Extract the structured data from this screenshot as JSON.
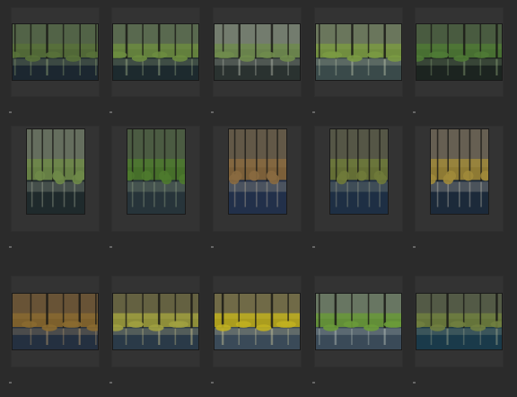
{
  "grid": {
    "items": [
      {
        "name": "photo-thumbnail-1",
        "orientation": "landscape",
        "palette": [
          "#2c3b2c",
          "#58713a",
          "#9bb07a",
          "#1c2730"
        ]
      },
      {
        "name": "photo-thumbnail-2",
        "orientation": "landscape",
        "palette": [
          "#30402f",
          "#6c8c3f",
          "#a7b88c",
          "#1d2a2e"
        ]
      },
      {
        "name": "photo-thumbnail-3",
        "orientation": "landscape",
        "palette": [
          "#4a5548",
          "#6f8b4d",
          "#bfc6b8",
          "#2a3230"
        ]
      },
      {
        "name": "photo-thumbnail-4",
        "orientation": "landscape",
        "palette": [
          "#3c4a30",
          "#7a9a42",
          "#c0c8b0",
          "#3a4a4a"
        ]
      },
      {
        "name": "photo-thumbnail-5",
        "orientation": "landscape",
        "palette": [
          "#263321",
          "#4f7a35",
          "#8da77a",
          "#1c2420"
        ]
      },
      {
        "name": "photo-thumbnail-6",
        "orientation": "portrait",
        "palette": [
          "#3a4336",
          "#6e8a48",
          "#b6c0a8",
          "#1f2a2c"
        ]
      },
      {
        "name": "photo-thumbnail-7",
        "orientation": "portrait",
        "palette": [
          "#1f2e1a",
          "#4e7a2e",
          "#9fb08e",
          "#27343a"
        ]
      },
      {
        "name": "photo-thumbnail-8",
        "orientation": "portrait",
        "palette": [
          "#2b2418",
          "#8a6a40",
          "#c8bba0",
          "#22304a"
        ]
      },
      {
        "name": "photo-thumbnail-9",
        "orientation": "portrait",
        "palette": [
          "#2a2a20",
          "#6f7a3a",
          "#a5a890",
          "#1e2f44"
        ]
      },
      {
        "name": "photo-thumbnail-10",
        "orientation": "portrait",
        "palette": [
          "#2a2218",
          "#a08a3a",
          "#d8d0c0",
          "#1c2a3a"
        ]
      },
      {
        "name": "photo-thumbnail-11",
        "orientation": "landscape",
        "palette": [
          "#3a2a18",
          "#8a6a30",
          "#c0a070",
          "#243040"
        ]
      },
      {
        "name": "photo-thumbnail-12",
        "orientation": "landscape",
        "palette": [
          "#2a2a18",
          "#a0a040",
          "#d0c890",
          "#2a3a48"
        ]
      },
      {
        "name": "photo-thumbnail-13",
        "orientation": "landscape",
        "palette": [
          "#3a3418",
          "#c0b020",
          "#d8d0a0",
          "#3a4a58"
        ]
      },
      {
        "name": "photo-thumbnail-14",
        "orientation": "landscape",
        "palette": [
          "#3a4a30",
          "#6a9a3a",
          "#c0c8c0",
          "#3a4a58"
        ]
      },
      {
        "name": "photo-thumbnail-15",
        "orientation": "landscape",
        "palette": [
          "#2a3020",
          "#708040",
          "#a0a890",
          "#1a3a4a"
        ]
      }
    ]
  }
}
